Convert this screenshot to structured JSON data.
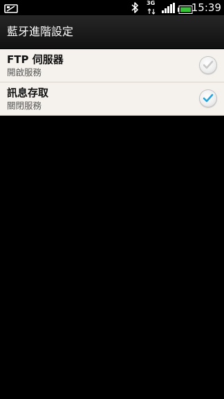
{
  "status_bar": {
    "time": "15:39",
    "network_type": "3G",
    "icons": [
      "notification-icon",
      "bluetooth-icon",
      "3g-data-icon",
      "signal-icon",
      "battery-icon"
    ],
    "battery_color": "#38c238"
  },
  "title_bar": {
    "title": "藍牙進階設定"
  },
  "settings": [
    {
      "title": "FTP 伺服器",
      "subtitle": "開啟服務",
      "checked": false
    },
    {
      "title": "訊息存取",
      "subtitle": "關閉服務",
      "checked": true
    }
  ],
  "colors": {
    "check_active": "#2aa3d9",
    "check_inactive": "#c8c8c8",
    "list_background": "#f5f2ed"
  }
}
